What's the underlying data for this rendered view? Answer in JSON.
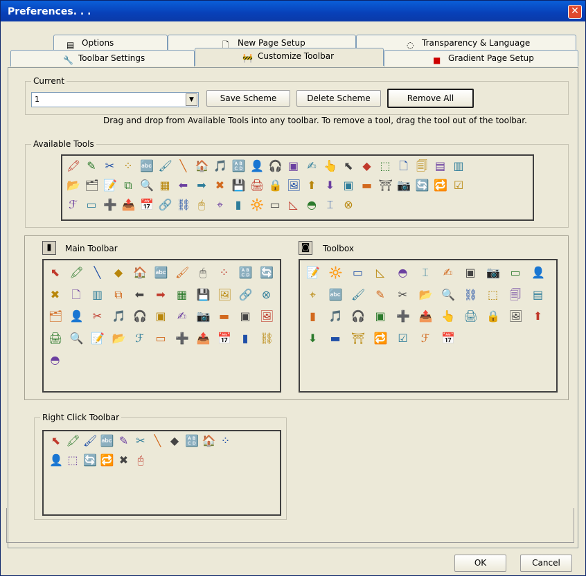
{
  "window": {
    "title": "Preferences. . .",
    "close": "✕"
  },
  "tabs": {
    "row1": [
      {
        "label": "Options",
        "icon": "▤"
      },
      {
        "label": "New Page Setup",
        "icon": "🗋"
      },
      {
        "label": "Transparency & Language",
        "icon": "◌"
      }
    ],
    "row2": [
      {
        "label": "Toolbar Settings",
        "icon": "🔧"
      },
      {
        "label": "Customize Toolbar",
        "icon": "🚧"
      },
      {
        "label": "Gradient Page Setup",
        "icon": "■"
      }
    ]
  },
  "current": {
    "legend": "Current",
    "value": "1",
    "arrow": "▼",
    "save": "Save Scheme",
    "delete": "Delete Scheme",
    "remove": "Remove All"
  },
  "hint": "Drag and drop from Available Tools into any toolbar.  To remove a tool, drag the tool out of the toolbar.",
  "available": {
    "legend": "Available Tools",
    "icons": [
      [
        "🖍",
        "✎",
        "✂",
        "⁘",
        "🔤",
        "🖌",
        "╲",
        "🏠",
        "🎵",
        "🔠",
        "👤",
        "🎧",
        "▣",
        "✍",
        "👆",
        "⬉",
        "◆",
        "⬚",
        "🗋",
        "🗐",
        "▤",
        "▥"
      ],
      [
        "📂",
        "🗂",
        "📝",
        "⧉",
        "🔍",
        "▦",
        "⬅",
        "➡",
        "✖",
        "💾",
        "🖨",
        "🔒",
        "🖼",
        "⬆",
        "⬇",
        "▣",
        "▬",
        "⛩",
        "📷",
        "🔄",
        "🔁",
        "☑"
      ],
      [
        "ℱ",
        "▭",
        "➕",
        "📤",
        "📅",
        "🔗",
        "⛓",
        "🖱",
        "⌖",
        "▮",
        "🔆",
        "▭",
        "◺",
        "◓",
        "⌶",
        "⊗"
      ]
    ]
  },
  "main": {
    "label": "Main Toolbar",
    "icon": "▮",
    "icons": [
      [
        "⬉",
        "🖍",
        "╲",
        "◆",
        "🏠",
        "🔤",
        "🖌",
        "🖱",
        "⁘",
        "🔠",
        "🔄"
      ],
      [
        "✖",
        "🗋",
        "▥",
        "⧉",
        "⬅",
        "➡",
        "▦",
        "💾",
        "🖼",
        "🔗",
        "⊗"
      ],
      [
        "🗂",
        "👤",
        "✂",
        "🎵",
        "🎧",
        "▣",
        "✍",
        "📷",
        "▬",
        "▣",
        "🖼"
      ],
      [
        "🖨",
        "🔍",
        "📝",
        "📂",
        "ℱ",
        "▭",
        "➕",
        "📤",
        "📅",
        "▮",
        "⛓"
      ],
      [
        "◓"
      ]
    ]
  },
  "toolbox": {
    "label": "Toolbox",
    "icon": "◙",
    "icons": [
      [
        "📝",
        "🔆",
        "▭",
        "◺",
        "◓",
        "⌶",
        "✍",
        "▣",
        "📷",
        "▭",
        "👤"
      ],
      [
        "⌖",
        "🔤",
        "🖌",
        "✎",
        "✂",
        "📂",
        "🔍",
        "⛓",
        "⬚",
        "🗐",
        "▤"
      ],
      [
        "▮",
        "🎵",
        "🎧",
        "▣",
        "➕",
        "📤",
        "👆",
        "🖨",
        "🔒",
        "🖼",
        "⬆"
      ],
      [
        "⬇",
        "▬",
        "⛩",
        "🔁",
        "☑",
        "ℱ",
        "📅"
      ]
    ]
  },
  "right": {
    "legend": "Right Click Toolbar",
    "icons": [
      [
        "⬉",
        "🖍",
        "🖌",
        "🔤",
        "✎",
        "✂",
        "╲",
        "◆",
        "🔠",
        "🏠",
        "⁘"
      ],
      [
        "👤",
        "⬚",
        "🔄",
        "🔁",
        "✖",
        "🖰"
      ]
    ]
  },
  "footer": {
    "ok": "OK",
    "cancel": "Cancel"
  }
}
